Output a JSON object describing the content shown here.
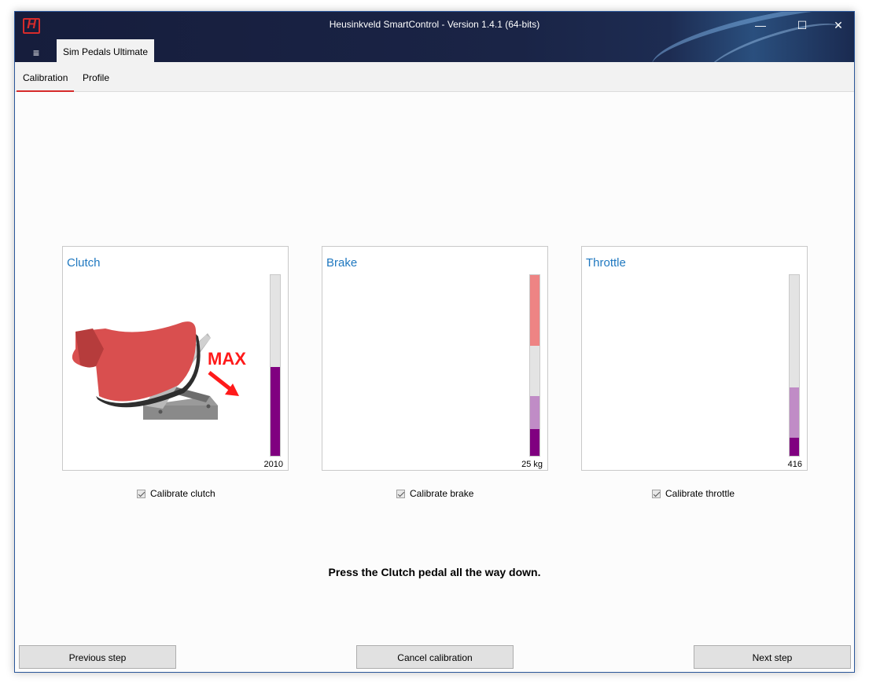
{
  "window": {
    "title": "Heusinkveld SmartControl - Version 1.4.1 (64-bits)",
    "logo_text": "H",
    "minimize_glyph": "—",
    "maximize_glyph": "☐",
    "close_glyph": "✕",
    "menu_glyph": "≡",
    "device_tab": "Sim Pedals Ultimate"
  },
  "subtabs": [
    "Calibration",
    "Profile"
  ],
  "pedals": [
    {
      "name": "Clutch",
      "value": "2010",
      "bar": {
        "filled_fraction": 0.49,
        "fill_color": "#800080",
        "track_color": "#e3e3e3"
      },
      "checkbox_label": "Calibrate clutch",
      "checked": true,
      "illustration": {
        "label": "MAX",
        "icon": "pedal-foot-press-icon",
        "label_color": "#ff1a1a",
        "foot_color": "#d94f4f",
        "pedal_color": "#a9a9a9"
      }
    },
    {
      "name": "Brake",
      "value": "25 kg",
      "bar": {
        "segments": [
          {
            "from": 0.0,
            "to": 0.15,
            "color": "#800080"
          },
          {
            "from": 0.15,
            "to": 0.33,
            "color": "#c08cc6"
          },
          {
            "from": 0.33,
            "to": 0.61,
            "color": "#e3e3e3"
          },
          {
            "from": 0.61,
            "to": 1.0,
            "color": "#ee8484"
          }
        ]
      },
      "checkbox_label": "Calibrate brake",
      "checked": true
    },
    {
      "name": "Throttle",
      "value": "416",
      "bar": {
        "segments": [
          {
            "from": 0.0,
            "to": 0.1,
            "color": "#800080"
          },
          {
            "from": 0.1,
            "to": 0.38,
            "color": "#c08cc6"
          },
          {
            "from": 0.38,
            "to": 1.0,
            "color": "#e3e3e3"
          }
        ]
      },
      "checkbox_label": "Calibrate throttle",
      "checked": true
    }
  ],
  "instruction": "Press the Clutch pedal all the way down.",
  "buttons": {
    "previous": "Previous step",
    "cancel": "Cancel calibration",
    "next": "Next step"
  }
}
